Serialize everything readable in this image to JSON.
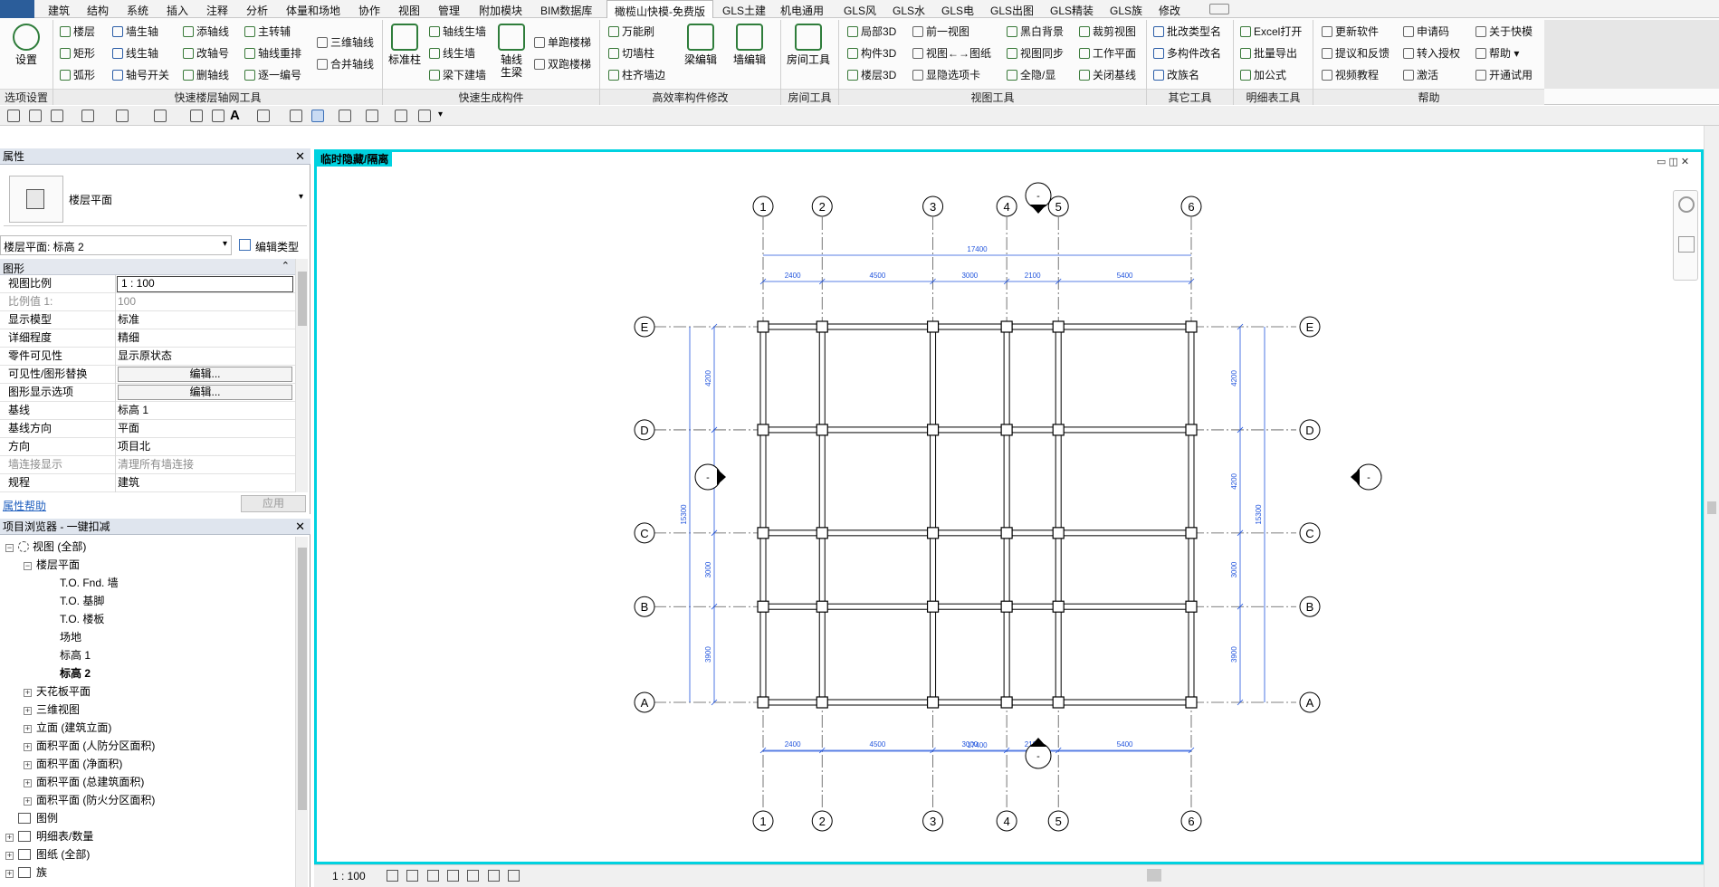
{
  "ribbon_tabs": [
    {
      "label": "建筑"
    },
    {
      "label": "结构"
    },
    {
      "label": "系统"
    },
    {
      "label": "插入"
    },
    {
      "label": "注释"
    },
    {
      "label": "分析"
    },
    {
      "label": "体量和场地"
    },
    {
      "label": "协作"
    },
    {
      "label": "视图"
    },
    {
      "label": "管理"
    },
    {
      "label": "附加模块"
    },
    {
      "label": "BIM数据库"
    },
    {
      "label": "橄榄山快模-免费版"
    },
    {
      "label": "GLS土建"
    },
    {
      "label": "机电通用"
    },
    {
      "label": "GLS风"
    },
    {
      "label": "GLS水"
    },
    {
      "label": "GLS电"
    },
    {
      "label": "GLS出图"
    },
    {
      "label": "GLS精装"
    },
    {
      "label": "GLS族"
    },
    {
      "label": "修改"
    }
  ],
  "ribbon": {
    "settings": "设置",
    "grid_a": [
      "楼层",
      "矩形",
      "弧形"
    ],
    "grid_b": [
      "墙生轴",
      "线生轴",
      "轴号开关"
    ],
    "grid_c": [
      "添轴线",
      "改轴号",
      "删轴线"
    ],
    "grid_d": [
      "主转辅",
      "轴线重排",
      "逐一编号"
    ],
    "grid_e": [
      "三维轴线",
      "合并轴线"
    ],
    "col_big": "标准柱",
    "comp_a": [
      "轴线生墙",
      "线生墙",
      "梁下建墙"
    ],
    "comp_big": "轴线生梁",
    "comp_c": [
      "单跑楼梯",
      "双跑楼梯"
    ],
    "eff_a": [
      "万能刷",
      "切墙柱",
      "柱齐墙边"
    ],
    "beam_edit": "梁编辑",
    "wall_edit": "墙编辑",
    "room_tool": "房间工具",
    "view_a": [
      "局部3D",
      "构件3D",
      "楼层3D"
    ],
    "view_b": [
      "前一视图",
      "视图←→图纸",
      "显隐选项卡"
    ],
    "view_c": [
      "黑白背景",
      "视图同步",
      "全隐/显"
    ],
    "view_d": [
      "裁剪视图",
      "工作平面",
      "关闭基线"
    ],
    "other": [
      "批改类型名",
      "多构件改名",
      "改族名"
    ],
    "sched": [
      "Excel打开",
      "批量导出",
      "加公式"
    ],
    "help_a": [
      "更新软件",
      "提议和反馈",
      "视频教程"
    ],
    "help_b": [
      "申请码",
      "转入授权",
      "激活"
    ],
    "help_c": [
      "关于快模",
      "帮助 ▾",
      "开通试用"
    ],
    "panels": [
      "选项设置",
      "快速楼层轴网工具",
      "快速生成构件",
      "高效率构件修改",
      "房间工具",
      "视图工具",
      "其它工具",
      "明细表工具",
      "帮助"
    ]
  },
  "properties": {
    "title": "属性",
    "type_name": "楼层平面",
    "instance_label": "楼层平面: 标高 2",
    "edit_type": "编辑类型",
    "section": "图形",
    "rows": [
      {
        "k": "视图比例",
        "v": "1 : 100"
      },
      {
        "k": "比例值 1:",
        "v": "100"
      },
      {
        "k": "显示模型",
        "v": "标准"
      },
      {
        "k": "详细程度",
        "v": "精细"
      },
      {
        "k": "零件可见性",
        "v": "显示原状态"
      },
      {
        "k": "可见性/图形替换",
        "v": "编辑..."
      },
      {
        "k": "图形显示选项",
        "v": "编辑..."
      },
      {
        "k": "基线",
        "v": "标高 1"
      },
      {
        "k": "基线方向",
        "v": "平面"
      },
      {
        "k": "方向",
        "v": "项目北"
      },
      {
        "k": "墙连接显示",
        "v": "清理所有墙连接"
      },
      {
        "k": "规程",
        "v": "建筑"
      }
    ],
    "help_link": "属性帮助",
    "apply": "应用"
  },
  "browser": {
    "title": "项目浏览器 - 一键扣减",
    "nodes": [
      {
        "label": "视图 (全部)"
      },
      {
        "label": "楼层平面"
      },
      {
        "label": "T.O. Fnd. 墙"
      },
      {
        "label": "T.O. 基脚"
      },
      {
        "label": "T.O. 楼板"
      },
      {
        "label": "场地"
      },
      {
        "label": "标高 1"
      },
      {
        "label": "标高 2"
      },
      {
        "label": "天花板平面"
      },
      {
        "label": "三维视图"
      },
      {
        "label": "立面 (建筑立面)"
      },
      {
        "label": "面积平面 (人防分区面积)"
      },
      {
        "label": "面积平面 (净面积)"
      },
      {
        "label": "面积平面 (总建筑面积)"
      },
      {
        "label": "面积平面 (防火分区面积)"
      },
      {
        "label": "图例"
      },
      {
        "label": "明细表/数量"
      },
      {
        "label": "图纸 (全部)"
      },
      {
        "label": "族"
      }
    ]
  },
  "view": {
    "label": "临时隐藏/隔离",
    "scale": "1 : 100",
    "grid_x_labels": [
      "1",
      "2",
      "3",
      "4",
      "5",
      "6"
    ],
    "grid_x_spacing": [
      2400,
      4500,
      3000,
      2100,
      5400
    ],
    "grid_x_spacing_text": [
      "2400",
      "4500",
      "3000",
      "2100",
      "5400"
    ],
    "grid_x_total": "17400",
    "grid_y_labels": [
      "A",
      "B",
      "C",
      "D",
      "E"
    ],
    "grid_y_spacing": [
      3900,
      3000,
      4200,
      4200
    ],
    "grid_y_spacing_text": [
      "3900",
      "3000",
      "4200",
      "4200"
    ],
    "grid_y_total": "15300",
    "elev_mark": "-"
  },
  "colors": {
    "accent": "#00d2e0",
    "dimension": "#2255dd"
  }
}
